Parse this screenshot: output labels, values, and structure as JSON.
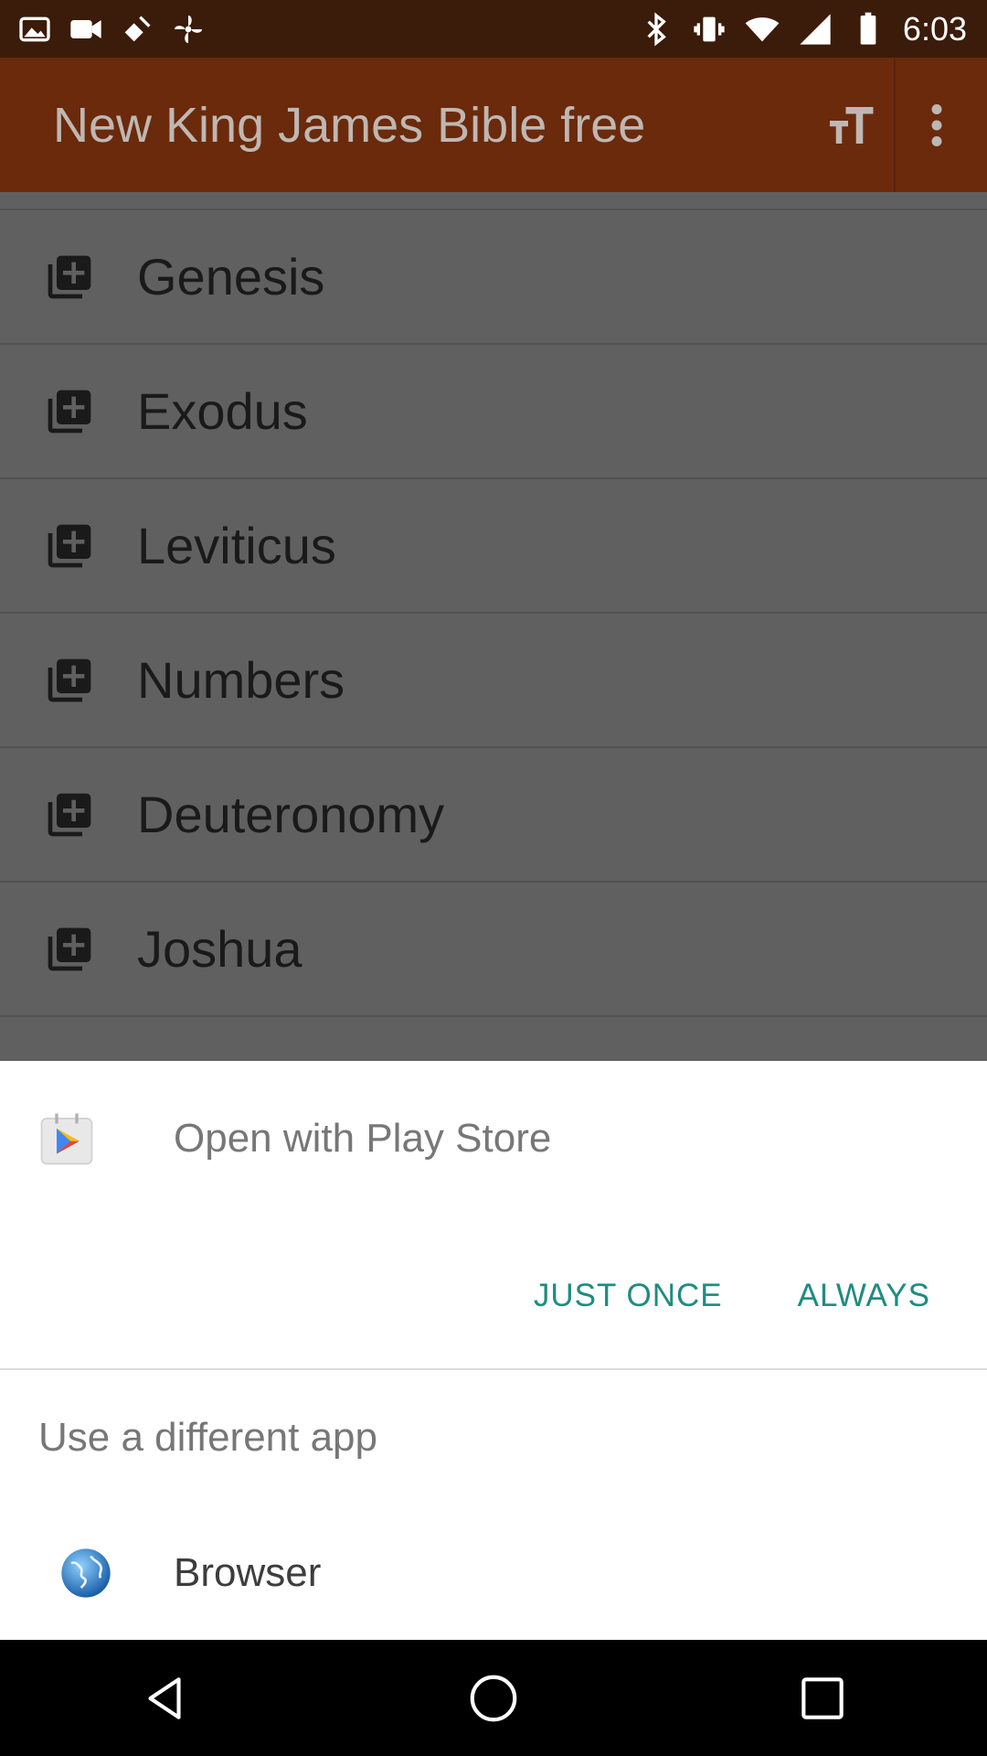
{
  "status_bar": {
    "time": "6:03",
    "left_icons": [
      "image-icon",
      "video-call-icon",
      "satellite-icon",
      "fan-icon"
    ],
    "right_icons": [
      "bluetooth-icon",
      "vibrate-icon",
      "wifi-icon",
      "signal-icon",
      "battery-icon"
    ]
  },
  "app_bar": {
    "title": "New King James Bible free",
    "icons": [
      "text-size-icon",
      "more-vert-icon"
    ]
  },
  "books": [
    {
      "label": "Genesis"
    },
    {
      "label": "Exodus"
    },
    {
      "label": "Leviticus"
    },
    {
      "label": "Numbers"
    },
    {
      "label": "Deuteronomy"
    },
    {
      "label": "Joshua"
    }
  ],
  "sheet": {
    "open_with": "Open with Play Store",
    "just_once": "JUST ONCE",
    "always": "ALWAYS",
    "use_different": "Use a different app",
    "browser_label": "Browser",
    "accent": "#1e8c80"
  },
  "nav": {
    "icons": [
      "back-icon",
      "home-icon",
      "recents-icon"
    ]
  }
}
